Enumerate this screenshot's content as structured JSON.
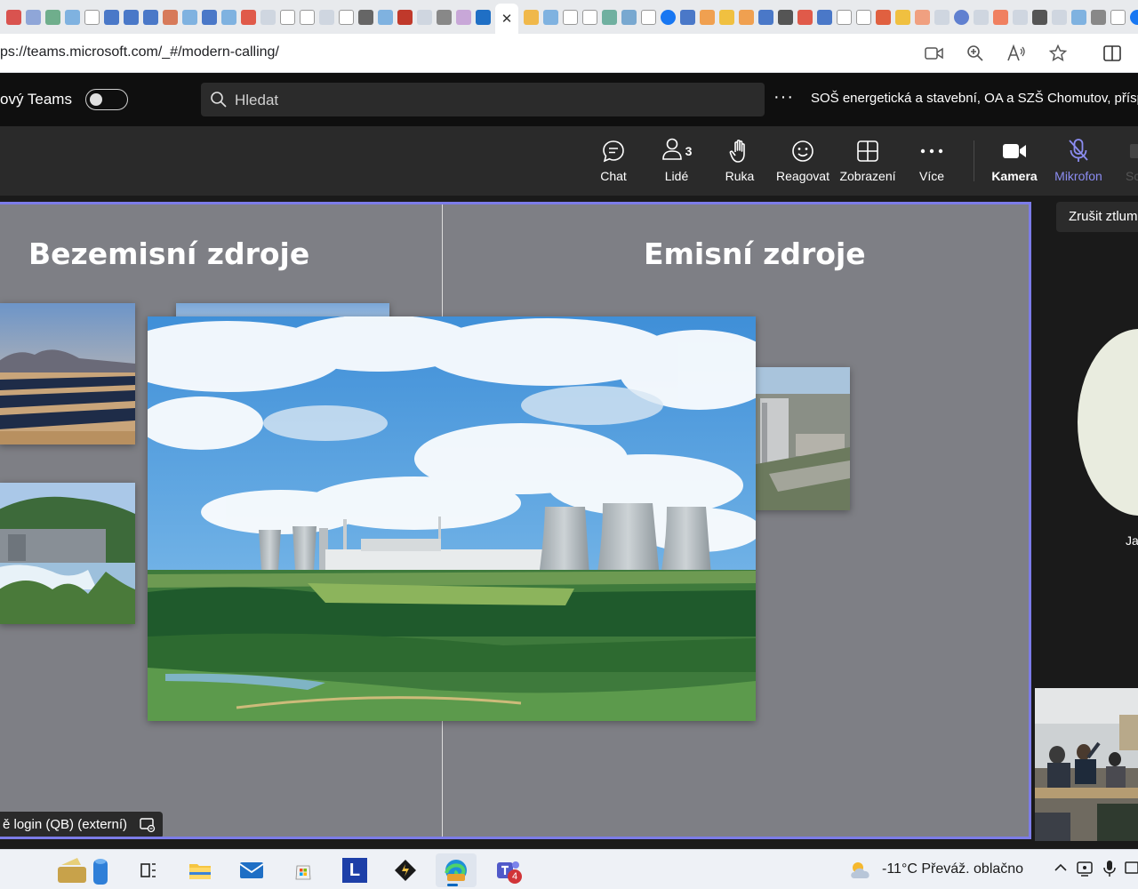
{
  "browser": {
    "url": "ps://teams.microsoft.com/_#/modern-calling/",
    "active_tab_close": "✕"
  },
  "teams": {
    "new_teams_label": "ový Teams",
    "search_placeholder": "Hledat",
    "more": "···",
    "org_name": "SOŠ energetická a stavební, OA a SZŠ Chomutov, přísp"
  },
  "toolbar": {
    "chat": "Chat",
    "people": "Lidé",
    "people_count": "3",
    "hand": "Ruka",
    "react": "Reagovat",
    "view": "Zobrazení",
    "more": "Více",
    "camera": "Kamera",
    "mic": "Mikrofon",
    "share_partial": "Sc"
  },
  "tooltip": "Zrušit ztlum",
  "slide": {
    "left_title": "Bezemisní zdroje",
    "right_title": "Emisní zdroje"
  },
  "presenter_label": "ě login (QB) (externí)",
  "participant_name": "Ja",
  "taskbar": {
    "notification_badge": "4",
    "letter_app": "L",
    "weather": "-11°C  Převáž. oblačno"
  },
  "colors": {
    "frame_accent": "#7c7ce8",
    "mic_accent": "#8b8cf0",
    "slide_bg": "#7e7f85"
  }
}
